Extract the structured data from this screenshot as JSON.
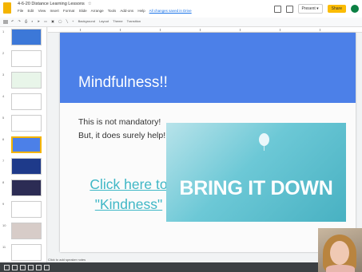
{
  "app": {
    "doc_title": "4-6-20 Distance Learning Lessons",
    "menus": [
      "File",
      "Edit",
      "View",
      "Insert",
      "Format",
      "Slide",
      "Arrange",
      "Tools",
      "Add-ons",
      "Help"
    ],
    "edit_note": "All changes saved in Drive"
  },
  "header": {
    "present_label": "Present",
    "share_label": "Share"
  },
  "toolbar": {
    "items": [
      "Background",
      "Layout",
      "Theme",
      "Transition"
    ]
  },
  "filmstrip": {
    "slides": [
      "1",
      "2",
      "3",
      "4",
      "5",
      "6",
      "7",
      "8",
      "9",
      "10",
      "11"
    ],
    "active_index": 5
  },
  "slide": {
    "title": "Mindfulness!!",
    "body_line1": "This is not mandatory!",
    "body_line2": "But, it does surely help!",
    "link_line1": "Click here to",
    "link_line2": "\"Kindness\"",
    "image_text": "BRING IT DOWN",
    "header_color": "#4c80e8",
    "link_color": "#3fb7c6"
  },
  "notes": {
    "placeholder": "Click to add speaker notes"
  }
}
